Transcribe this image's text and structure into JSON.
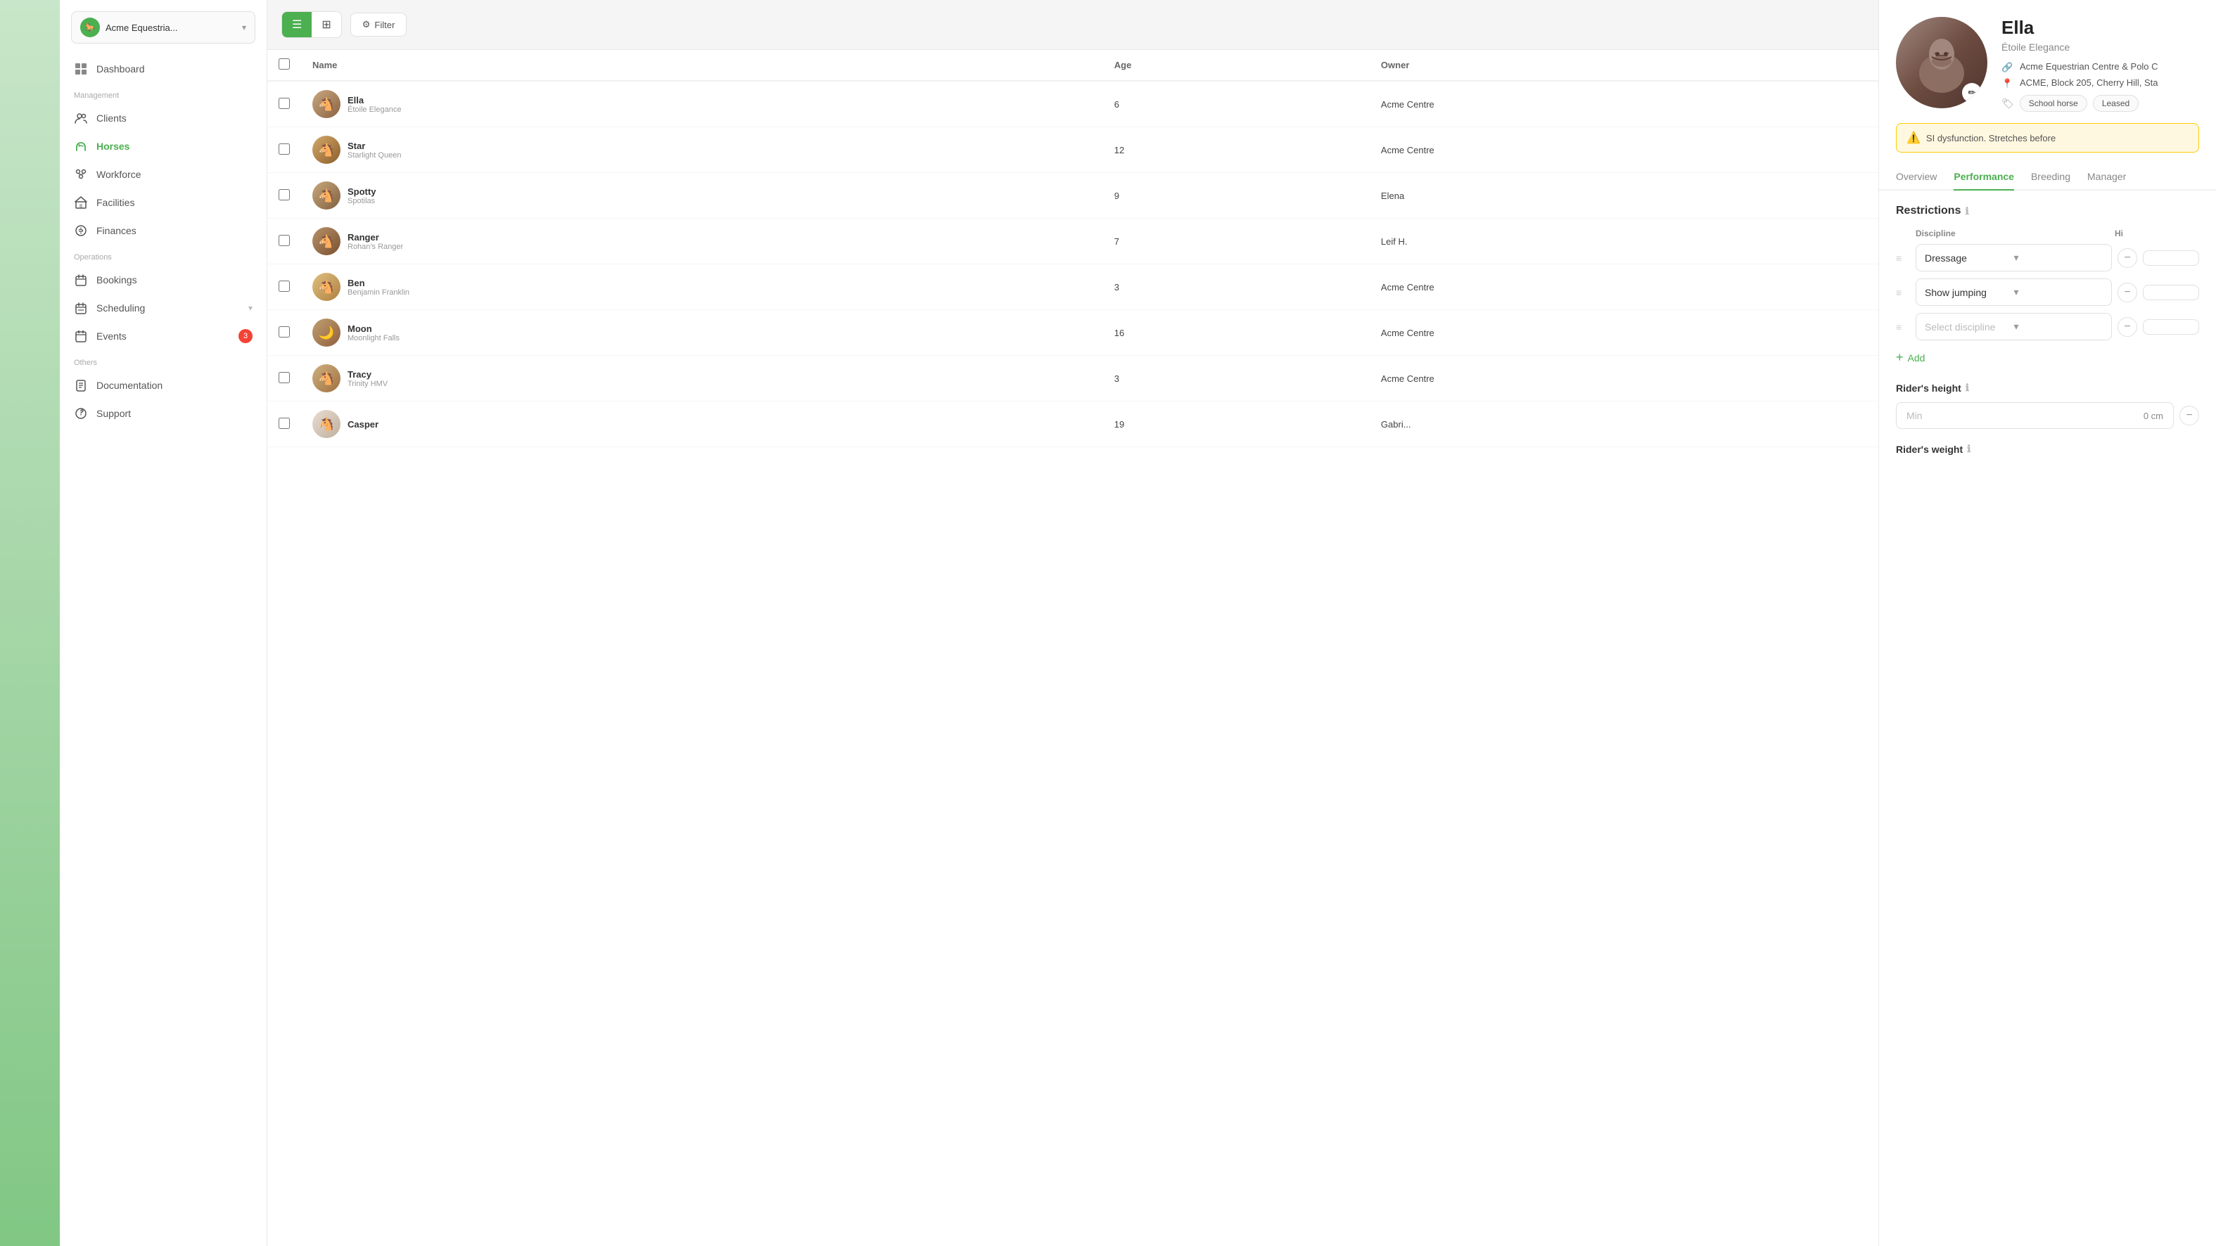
{
  "app": {
    "org_name": "Acme Equestria...",
    "org_icon": "🐎"
  },
  "sidebar": {
    "nav_items": [
      {
        "id": "dashboard",
        "label": "Dashboard",
        "icon": "grid",
        "section": null
      },
      {
        "id": "clients",
        "label": "Clients",
        "icon": "people",
        "section": "Management"
      },
      {
        "id": "horses",
        "label": "Horses",
        "icon": "horse",
        "section": null,
        "active": true
      },
      {
        "id": "workforce",
        "label": "Workforce",
        "icon": "org",
        "section": null
      },
      {
        "id": "facilities",
        "label": "Facilities",
        "icon": "building",
        "section": null
      },
      {
        "id": "finances",
        "label": "Finances",
        "icon": "wallet",
        "section": null
      },
      {
        "id": "bookings",
        "label": "Bookings",
        "icon": "calendar",
        "section": "Operations"
      },
      {
        "id": "scheduling",
        "label": "Scheduling",
        "icon": "cal2",
        "section": null,
        "has_chevron": true
      },
      {
        "id": "events",
        "label": "Events",
        "icon": "events",
        "section": null,
        "badge": 3
      },
      {
        "id": "documentation",
        "label": "Documentation",
        "icon": "doc",
        "section": "Others"
      },
      {
        "id": "support",
        "label": "Support",
        "icon": "help",
        "section": null
      }
    ],
    "sections": {
      "management": "Management",
      "operations": "Operations",
      "others": "Others"
    }
  },
  "toolbar": {
    "filter_label": "Filter",
    "list_view_active": true
  },
  "table": {
    "columns": [
      "Name",
      "Age",
      "Owner"
    ],
    "horses": [
      {
        "id": 1,
        "name": "Ella",
        "subtitle": "Étoile Elegance",
        "age": 6,
        "owner": "Acme Centre",
        "avatar_class": "avatar-ella",
        "emoji": "🐴"
      },
      {
        "id": 2,
        "name": "Star",
        "subtitle": "Starlight Queen",
        "age": 12,
        "owner": "Acme Centre",
        "avatar_class": "avatar-star",
        "emoji": "🐴"
      },
      {
        "id": 3,
        "name": "Spotty",
        "subtitle": "Spotilas",
        "age": 9,
        "owner": "Elena",
        "avatar_class": "avatar-spotty",
        "emoji": "🐴"
      },
      {
        "id": 4,
        "name": "Ranger",
        "subtitle": "Rohan's Ranger",
        "age": 7,
        "owner": "Leif H.",
        "avatar_class": "avatar-ranger",
        "emoji": "🐴"
      },
      {
        "id": 5,
        "name": "Ben",
        "subtitle": "Benjamin Franklin",
        "age": 3,
        "owner": "Acme Centre",
        "avatar_class": "avatar-ben",
        "emoji": "🐴"
      },
      {
        "id": 6,
        "name": "Moon",
        "subtitle": "Moonlight Falls",
        "age": 16,
        "owner": "Acme Centre",
        "avatar_class": "avatar-moon",
        "emoji": "🌙"
      },
      {
        "id": 7,
        "name": "Tracy",
        "subtitle": "Trinity HMV",
        "age": 3,
        "owner": "Acme Centre",
        "avatar_class": "avatar-tracy",
        "emoji": "🐴"
      },
      {
        "id": 8,
        "name": "Casper",
        "subtitle": "",
        "age": 19,
        "owner": "Gabri...",
        "avatar_class": "avatar-casper",
        "emoji": "🐴"
      }
    ]
  },
  "right_panel": {
    "horse": {
      "name": "Ella",
      "subtitle": "Étoile Elegance",
      "organization": "Acme Equestrian Centre & Polo C",
      "location": "ACME, Block 205, Cherry Hill, Sta",
      "tags": [
        "School horse",
        "Leased"
      ],
      "alert": "SI dysfunction. Stretches before"
    },
    "tabs": [
      "Overview",
      "Performance",
      "Breeding",
      "Manager"
    ],
    "active_tab": "Performance",
    "performance": {
      "restrictions_title": "Restrictions",
      "discipline_col": "Discipline",
      "highest_col": "Hi",
      "disciplines": [
        {
          "value": "Dressage",
          "placeholder": false
        },
        {
          "value": "Show jumping",
          "placeholder": false
        },
        {
          "value": "Select discipline",
          "placeholder": true
        }
      ],
      "add_label": "Add",
      "rider_height_title": "Rider's height",
      "rider_height_min_label": "Min",
      "rider_height_min_value": "0 cm",
      "rider_weight_title": "Rider's weight"
    }
  }
}
